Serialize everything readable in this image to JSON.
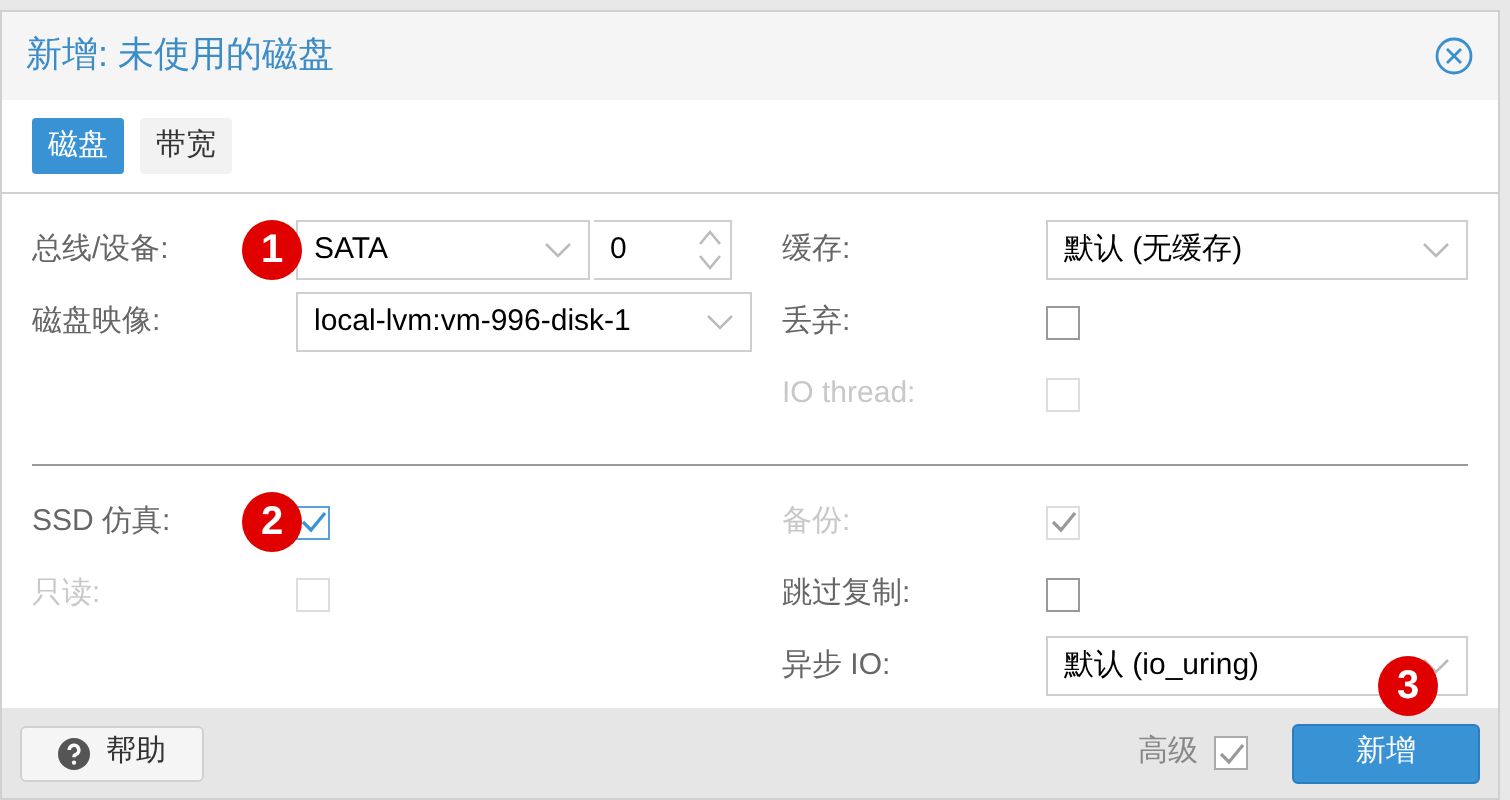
{
  "window": {
    "title": "新增: 未使用的磁盘"
  },
  "tabs": [
    {
      "label": "磁盘",
      "selected": true
    },
    {
      "label": "带宽",
      "selected": false
    }
  ],
  "sections": [
    {
      "left": [
        {
          "kind": "bus",
          "label": "总线/设备:",
          "value": "SATA",
          "number": "0",
          "badge": "1"
        },
        {
          "kind": "combo",
          "label": "磁盘映像:",
          "value": "local-lvm:vm-996-disk-1"
        }
      ],
      "right": [
        {
          "kind": "combo",
          "label": "缓存:",
          "value": "默认 (无缓存)"
        },
        {
          "kind": "checkbox",
          "label": "丢弃:",
          "checked": false,
          "disabled": false
        },
        {
          "kind": "checkbox",
          "label": "IO thread:",
          "checked": false,
          "disabled": true
        }
      ]
    },
    {
      "left": [
        {
          "kind": "checkbox",
          "label": "SSD 仿真:",
          "checked": true,
          "badge": "2",
          "disabled": false
        },
        {
          "kind": "checkbox",
          "label": "只读:",
          "checked": false,
          "disabled": true
        }
      ],
      "right": [
        {
          "kind": "checkbox",
          "label": "备份:",
          "checked": true,
          "disabled": true
        },
        {
          "kind": "checkbox",
          "label": "跳过复制:",
          "checked": false,
          "disabled": false
        },
        {
          "kind": "combo",
          "label": "异步 IO:",
          "value": "默认 (io_uring)"
        }
      ]
    }
  ],
  "footer": {
    "help": "帮助",
    "advanced": {
      "label": "高级",
      "checked": true
    },
    "add": {
      "label": "新增",
      "badge": "3"
    }
  }
}
